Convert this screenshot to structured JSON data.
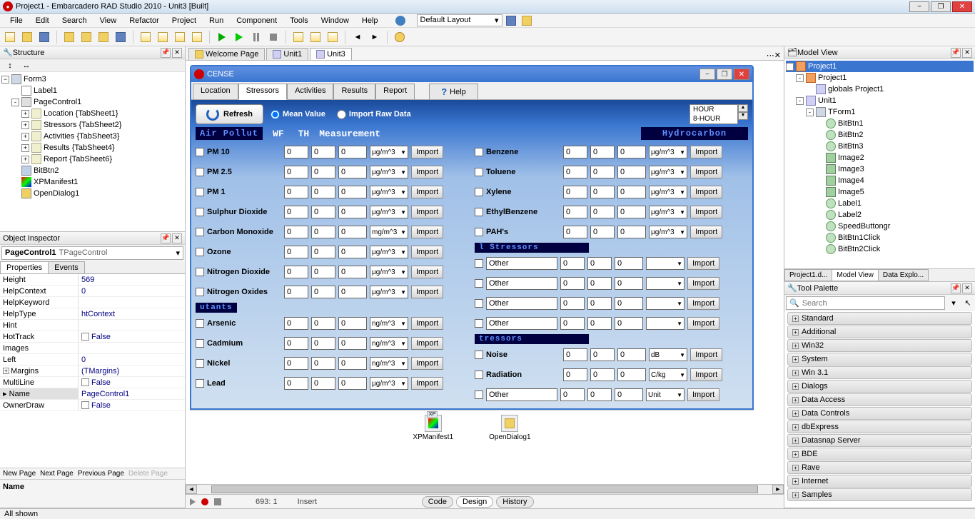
{
  "window": {
    "title": "Project1 - Embarcadero RAD Studio 2010 - Unit3 [Built]"
  },
  "menu": [
    "File",
    "Edit",
    "Search",
    "View",
    "Refactor",
    "Project",
    "Run",
    "Component",
    "Tools",
    "Window",
    "Help"
  ],
  "layout_combo": "Default Layout",
  "structure": {
    "title": "Structure",
    "root": "Form3",
    "items": [
      {
        "label": "Label1",
        "icon": "label",
        "ind": 1
      },
      {
        "label": "PageControl1",
        "icon": "page",
        "ind": 1,
        "exp": "-"
      },
      {
        "label": "Location {TabSheet1}",
        "icon": "sheet",
        "ind": 2,
        "exp": "+"
      },
      {
        "label": "Stressors {TabSheet2}",
        "icon": "sheet",
        "ind": 2,
        "exp": "+"
      },
      {
        "label": "Activities {TabSheet3}",
        "icon": "sheet",
        "ind": 2,
        "exp": "+"
      },
      {
        "label": "Results {TabSheet4}",
        "icon": "sheet",
        "ind": 2,
        "exp": "+"
      },
      {
        "label": "Report {TabSheet6}",
        "icon": "sheet",
        "ind": 2,
        "exp": "+"
      },
      {
        "label": "BitBtn2",
        "icon": "btn",
        "ind": 1
      },
      {
        "label": "XPManifest1",
        "icon": "xp",
        "ind": 1
      },
      {
        "label": "OpenDialog1",
        "icon": "dlg",
        "ind": 1
      }
    ]
  },
  "inspector": {
    "title": "Object Inspector",
    "selected_name": "PageControl1",
    "selected_class": "TPageControl",
    "tabs": [
      "Properties",
      "Events"
    ],
    "props": [
      {
        "k": "Height",
        "v": "569"
      },
      {
        "k": "HelpContext",
        "v": "0"
      },
      {
        "k": "HelpKeyword",
        "v": ""
      },
      {
        "k": "HelpType",
        "v": "htContext"
      },
      {
        "k": "Hint",
        "v": ""
      },
      {
        "k": "HotTrack",
        "v": "False",
        "chk": true
      },
      {
        "k": "Images",
        "v": ""
      },
      {
        "k": "Left",
        "v": "0"
      },
      {
        "k": "Margins",
        "v": "(TMargins)",
        "exp": "+"
      },
      {
        "k": "MultiLine",
        "v": "False",
        "chk": true
      },
      {
        "k": "Name",
        "v": "PageControl1",
        "sel": true
      },
      {
        "k": "OwnerDraw",
        "v": "False",
        "chk": true
      }
    ],
    "footer": [
      "New Page",
      "Next Page",
      "Previous Page",
      "Delete Page"
    ],
    "name_label": "Name"
  },
  "doctabs": [
    {
      "label": "Welcome Page",
      "icon": "home"
    },
    {
      "label": "Unit1",
      "icon": "unit"
    },
    {
      "label": "Unit3",
      "icon": "unit",
      "active": true
    }
  ],
  "app": {
    "title": "CENSE",
    "tabs": [
      "Location",
      "Stressors",
      "Activities",
      "Results",
      "Report"
    ],
    "active_tab": "Stressors",
    "help": "Help",
    "refresh": "Refresh",
    "radio1": "Mean Value",
    "radio2": "Import Raw Data",
    "hour_opts": [
      "HOUR",
      "8-HOUR"
    ],
    "head1": "Air Pollut",
    "head2": "Hydrocarbon",
    "col_wf": "WF",
    "col_th": "TH",
    "col_meas": "Measurement",
    "import_label": "Import",
    "left_rows": [
      {
        "lbl": "PM 10",
        "unit": "µg/m^3"
      },
      {
        "lbl": "PM 2.5",
        "unit": "µg/m^3"
      },
      {
        "lbl": "PM 1",
        "unit": "µg/m^3"
      },
      {
        "lbl": "Sulphur Dioxide",
        "unit": "µg/m^3"
      },
      {
        "lbl": "Carbon Monoxide",
        "unit": "mg/m^3"
      },
      {
        "lbl": "Ozone",
        "unit": "µg/m^3"
      },
      {
        "lbl": "Nitrogen Dioxide",
        "unit": "µg/m^3"
      },
      {
        "lbl": "Nitrogen Oxides",
        "unit": "µg/m^3"
      }
    ],
    "sub1": "utants",
    "left_rows2": [
      {
        "lbl": "Arsenic",
        "unit": "ng/m^3"
      },
      {
        "lbl": "Cadmium",
        "unit": "ng/m^3"
      },
      {
        "lbl": "Nickel",
        "unit": "ng/m^3"
      },
      {
        "lbl": "Lead",
        "unit": "µg/m^3"
      }
    ],
    "right_rows": [
      {
        "lbl": "Benzene",
        "unit": "µg/m^3"
      },
      {
        "lbl": "Toluene",
        "unit": "µg/m^3"
      },
      {
        "lbl": "Xylene",
        "unit": "µg/m^3"
      },
      {
        "lbl": "EthylBenzene",
        "unit": "µg/m^3"
      },
      {
        "lbl": "PAH's",
        "unit": "µg/m^3"
      }
    ],
    "sub2": "l Stressors",
    "other_label": "Other",
    "other_rows": [
      {},
      {},
      {},
      {}
    ],
    "sub3": "tressors",
    "phys_rows": [
      {
        "lbl": "Noise",
        "unit": "dB"
      },
      {
        "lbl": "Radiation",
        "unit": "C/kg"
      },
      {
        "lbl": "Other",
        "unit": "Unit",
        "other": true
      }
    ],
    "zero": "0",
    "tray": [
      {
        "label": "XPManifest1",
        "badge": "XP"
      },
      {
        "label": "OpenDialog1"
      }
    ]
  },
  "bottom": {
    "pos": "693:  1",
    "mode": "Insert",
    "tabs": [
      "Code",
      "Design",
      "History"
    ]
  },
  "modelview": {
    "title": "Model View",
    "tree": [
      {
        "label": "Project1",
        "ind": 0,
        "exp": "-",
        "icon": "proj",
        "sel": true
      },
      {
        "label": "Project1",
        "ind": 1,
        "exp": "-",
        "icon": "proj"
      },
      {
        "label": "globals Project1",
        "ind": 2,
        "icon": "unit"
      },
      {
        "label": "Unit1",
        "ind": 1,
        "exp": "-",
        "icon": "unit"
      },
      {
        "label": "TForm1",
        "ind": 2,
        "exp": "-",
        "icon": "form"
      },
      {
        "label": "BitBtn1",
        "ind": 3,
        "icon": "method"
      },
      {
        "label": "BitBtn2",
        "ind": 3,
        "icon": "method"
      },
      {
        "label": "BitBtn3",
        "ind": 3,
        "icon": "method"
      },
      {
        "label": "Image2",
        "ind": 3,
        "icon": "img"
      },
      {
        "label": "Image3",
        "ind": 3,
        "icon": "img"
      },
      {
        "label": "Image4",
        "ind": 3,
        "icon": "img"
      },
      {
        "label": "Image5",
        "ind": 3,
        "icon": "img"
      },
      {
        "label": "Label1",
        "ind": 3,
        "icon": "method"
      },
      {
        "label": "Label2",
        "ind": 3,
        "icon": "method"
      },
      {
        "label": "SpeedButtongr",
        "ind": 3,
        "icon": "method"
      },
      {
        "label": "BitBtn1Click",
        "ind": 3,
        "icon": "method"
      },
      {
        "label": "BitBtn2Click",
        "ind": 3,
        "icon": "method"
      }
    ],
    "tabs": [
      "Project1.d...",
      "Model View",
      "Data Explo..."
    ]
  },
  "palette": {
    "title": "Tool Palette",
    "search_placeholder": "Search",
    "cats": [
      "Standard",
      "Additional",
      "Win32",
      "System",
      "Win 3.1",
      "Dialogs",
      "Data Access",
      "Data Controls",
      "dbExpress",
      "Datasnap Server",
      "BDE",
      "Rave",
      "Internet",
      "Samples"
    ]
  },
  "status": "All shown"
}
